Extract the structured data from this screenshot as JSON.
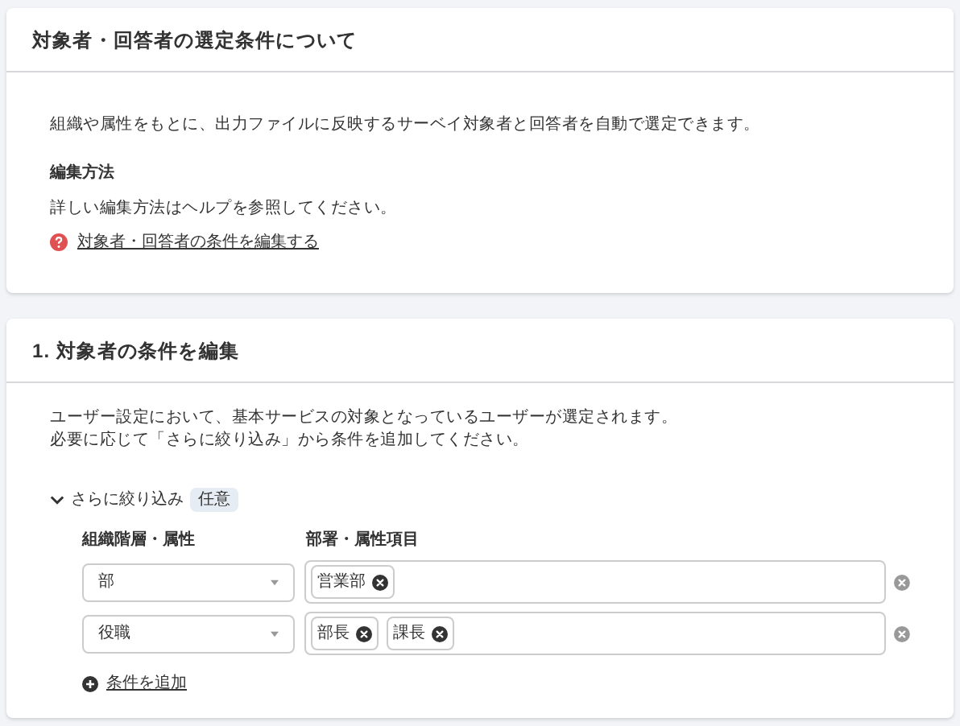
{
  "about_card": {
    "title": "対象者・回答者の選定条件について",
    "description": "組織や属性をもとに、出力ファイルに反映するサーベイ対象者と回答者を自動で選定できます。",
    "edit_method": {
      "heading": "編集方法",
      "text": "詳しい編集方法はヘルプを参照してください。",
      "help_link": "対象者・回答者の条件を編集する"
    }
  },
  "edit_card": {
    "title": "1. 対象者の条件を編集",
    "description_lines": [
      "ユーザー設定において、基本サービスの対象となっているユーザーが選定されます。",
      "必要に応じて「さらに絞り込み」から条件を追加してください。"
    ],
    "filter": {
      "label": "さらに絞り込み",
      "expanded": true,
      "badge": "任意",
      "columns": [
        "組織階層・属性",
        "部署・属性項目"
      ],
      "rows": [
        {
          "attribute": "部",
          "tags": [
            "営業部"
          ]
        },
        {
          "attribute": "役職",
          "tags": [
            "部長",
            "課長"
          ]
        }
      ],
      "add_link": "条件を追加"
    }
  }
}
